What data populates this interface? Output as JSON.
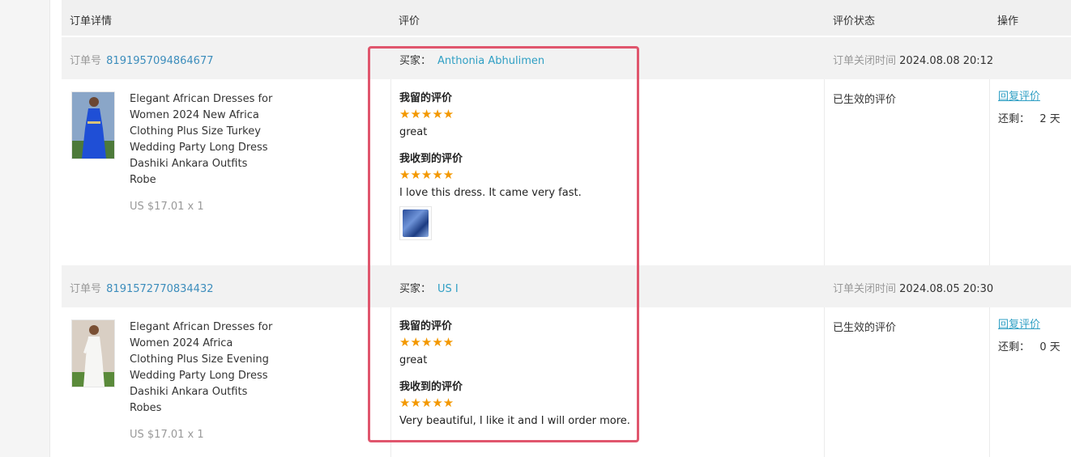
{
  "header": {
    "col_order": "订单详情",
    "col_review": "评价",
    "col_status": "评价状态",
    "col_ops": "操作"
  },
  "orders": [
    {
      "order_label": "订单号",
      "order_no": "8191957094864677",
      "buyer_label": "买家：",
      "buyer_name": "Anthonia Abhulimen",
      "closed_label": "订单关闭时间",
      "closed_time": "2024.08.08 20:12",
      "product_lines": [
        "Elegant African Dresses for",
        "Women 2024 New Africa",
        "Clothing Plus Size Turkey",
        "Wedding Party Long Dress",
        "Dashiki Ankara Outfits",
        "Robe"
      ],
      "price": "US $17.01 x 1",
      "my_review_label": "我留的评价",
      "my_review_stars": "★★★★★",
      "my_review_text": "great",
      "received_label": "我收到的评价",
      "received_stars": "★★★★★",
      "received_text": "I love this dress. It came very fast.",
      "status": "已生效的评价",
      "reply": "回复评价",
      "remaining": "还剩：   2 天"
    },
    {
      "order_label": "订单号",
      "order_no": "8191572770834432",
      "buyer_label": "买家：",
      "buyer_name": "US I",
      "closed_label": "订单关闭时间",
      "closed_time": "2024.08.05 20:30",
      "product_lines": [
        "Elegant African Dresses for",
        "Women 2024 Africa",
        "Clothing Plus Size Evening",
        "Wedding Party Long Dress",
        "Dashiki Ankara Outfits",
        "Robes"
      ],
      "price": "US $17.01 x 1",
      "my_review_label": "我留的评价",
      "my_review_stars": "★★★★★",
      "my_review_text": "great",
      "received_label": "我收到的评价",
      "received_stars": "★★★★★",
      "received_text": "Very beautiful, I like it and I will order more.",
      "status": "已生效的评价",
      "reply": "回复评价",
      "remaining": "还剩：   0 天"
    }
  ],
  "colors": {
    "link": "#2f9fc4",
    "star": "#f39800",
    "highlight": "#e0566d"
  }
}
